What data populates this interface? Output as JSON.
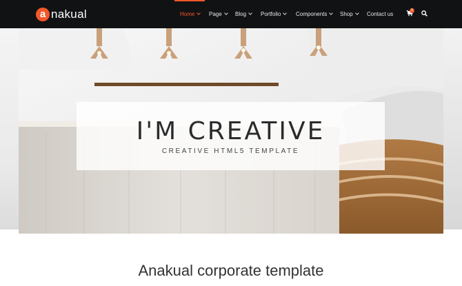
{
  "brand": {
    "mark": "a",
    "name": "nakual",
    "accent": "#f2572a"
  },
  "nav": {
    "items": [
      {
        "label": "Home",
        "active": true,
        "dropdown": true
      },
      {
        "label": "Page",
        "dropdown": true
      },
      {
        "label": "Blog",
        "dropdown": true
      },
      {
        "label": "Portfolio",
        "dropdown": true
      },
      {
        "label": "Components",
        "dropdown": true
      },
      {
        "label": "Shop",
        "dropdown": true
      },
      {
        "label": "Contact us",
        "dropdown": false
      }
    ],
    "cart_icon": "cart-icon",
    "cart_count": "0",
    "search_icon": "search-icon"
  },
  "hero": {
    "title": "I'M CREATIVE",
    "subtitle": "CREATIVE HTML5 TEMPLATE"
  },
  "section": {
    "title": "Anakual corporate template"
  }
}
